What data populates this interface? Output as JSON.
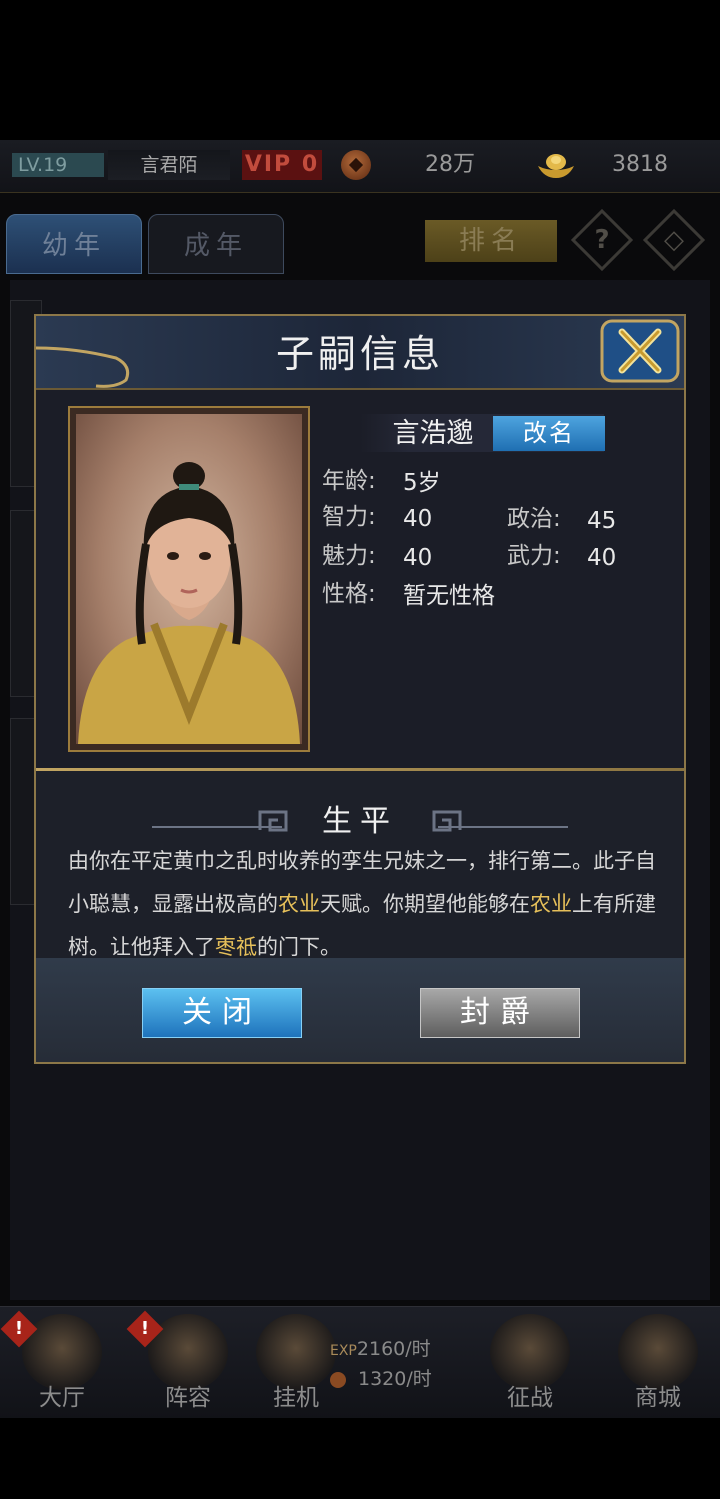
{
  "status": {
    "level": "LV.19",
    "player_name": "言君陌",
    "vip": "VIP 0",
    "coins": "28万",
    "ingots": "3818"
  },
  "tabs": [
    {
      "label": "幼年"
    },
    {
      "label": "成年"
    }
  ],
  "header_buttons": {
    "rank": "排名",
    "help_glyph": "?",
    "diamond_glyph": "◇"
  },
  "modal": {
    "title": "子嗣信息",
    "child_name": "言浩邈",
    "rename_label": "改名",
    "stats": {
      "age_label": "年龄:",
      "age_value": "5岁",
      "int_label": "智力:",
      "int_value": "40",
      "pol_label": "政治:",
      "pol_value": "45",
      "cha_label": "魅力:",
      "cha_value": "40",
      "war_label": "武力:",
      "war_value": "40",
      "trait_label": "性格:",
      "trait_value": "暂无性格"
    },
    "bio": {
      "title": "生平",
      "part1": "由你在平定黄巾之乱时收养的孪生兄妹之一，排行第二。此子自小聪慧，显露出极高的",
      "hl1": "农业",
      "part2": "天赋。你期望他能够在",
      "hl2": "农业",
      "part3": "上有所建树。让他拜入了",
      "hl3": "枣祗",
      "part4": "的门下。"
    },
    "close_label": "关闭",
    "title_label": "封爵"
  },
  "nav": {
    "hall": "大厅",
    "lineup": "阵容",
    "idle": "挂机",
    "exp_rate": "2160/时",
    "exp_tag": "EXP",
    "coin_rate": "1320/时",
    "battle": "征战",
    "shop": "商城",
    "badge": "!"
  },
  "colors": {
    "gold_border": "#8c7748",
    "blue_button": "#1e73bc",
    "highlight": "#e6c05a"
  }
}
